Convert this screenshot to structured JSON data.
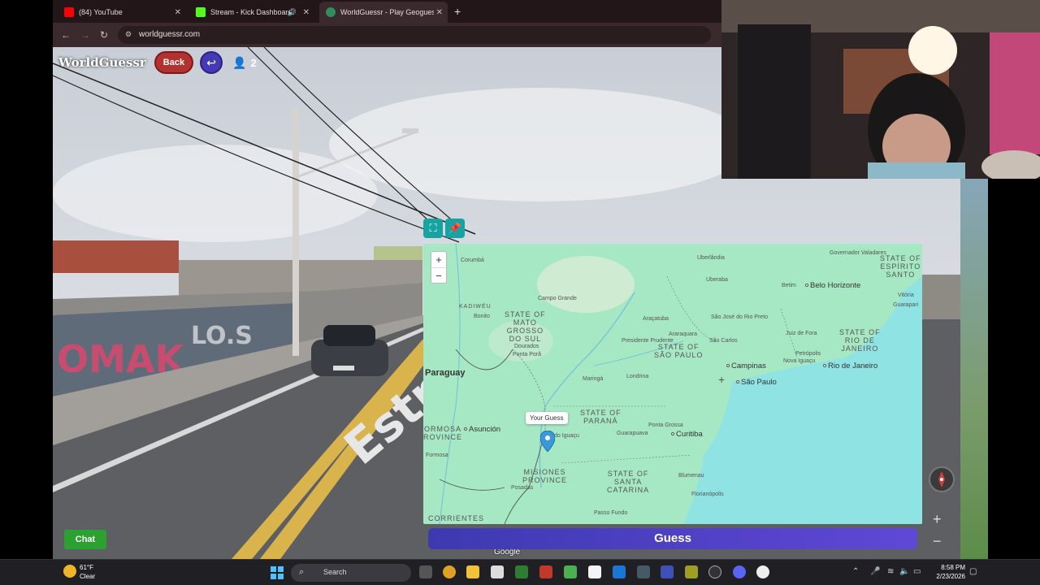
{
  "browser": {
    "tabs": [
      {
        "label": "(84) YouTube",
        "icon": "youtube-icon",
        "color": "#ff0000"
      },
      {
        "label": "Stream - Kick Dashboard",
        "icon": "kick-icon",
        "color": "#53fc18"
      },
      {
        "label": "WorldGuessr - Play Geoguessr",
        "icon": "globe-icon",
        "color": "#2f8f5a"
      }
    ],
    "url": "worldguessr.com"
  },
  "game": {
    "logo": "WorldGuessr",
    "back_label": "Back",
    "player_count": "2",
    "chat_label": "Chat",
    "guess_label": "Guess",
    "road_text": "Estr"
  },
  "map": {
    "tooltip": "Your Guess",
    "attribution": "Google",
    "countries": [
      "Paraguay"
    ],
    "states": [
      {
        "label": "STATE OF\nMATO\nGROSSO\nDO SUL"
      },
      {
        "label": "STATE OF\nSÃO PAULO"
      },
      {
        "label": "STATE OF\nPARANÁ"
      },
      {
        "label": "STATE OF\nSANTA\nCATARINA"
      },
      {
        "label": "STATE OF\nRIO DE\nJANEIRO"
      },
      {
        "label": "STATE OF\nESPÍRITO\nSANTO"
      },
      {
        "label": "MISIONES\nPROVINCE"
      },
      {
        "label": "ORMOSA\nROVINCE"
      },
      {
        "label": "CORRIENTES"
      },
      {
        "label": "KADIWÉU"
      }
    ],
    "big_cities": [
      "Belo Horizonte",
      "Campinas",
      "São Paulo",
      "Rio de Janeiro",
      "Curitiba",
      "Asunción"
    ],
    "cities": [
      "Corumbá",
      "Campo Grande",
      "Bonito",
      "Uberlândia",
      "Uberaba",
      "Governador Valadares",
      "Vitória",
      "Guarapari",
      "Betim",
      "Araçatuba",
      "São José do Rio Preto",
      "Presidente Prudente",
      "Araraquara",
      "São Carlos",
      "Juiz de Fora",
      "Petrópolis",
      "Nova Iguaçu",
      "Dourados",
      "Ponta Porã",
      "Maringá",
      "Londrina",
      "Ponta Grossa",
      "Guarapuava",
      "Blumenau",
      "Florianópolis",
      "Passo Fundo",
      "Formosa",
      "Posadas",
      "do Iguaçu"
    ]
  },
  "taskbar": {
    "temp": "61°F",
    "condition": "Clear",
    "search_label": "Search",
    "time": "8:58 PM",
    "date": "2/23/2026",
    "notification_count": "2"
  }
}
